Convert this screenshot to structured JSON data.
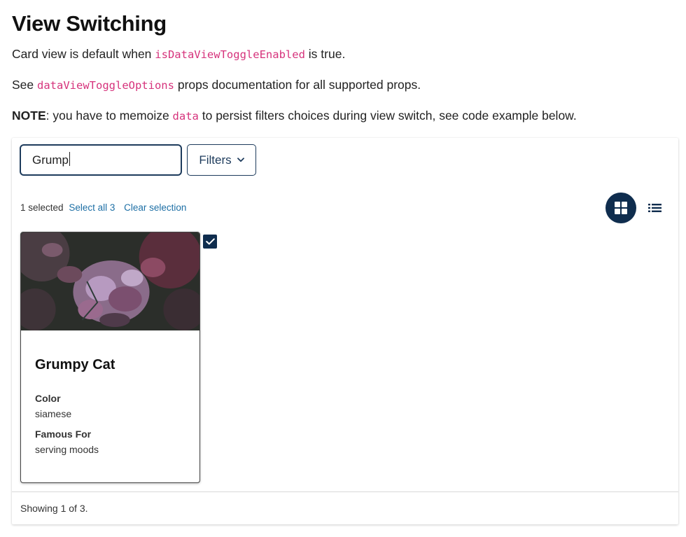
{
  "header": {
    "title": "View Switching",
    "p1_before": "Card view is default when ",
    "p1_code": "isDataViewToggleEnabled",
    "p1_after": " is true.",
    "p2_before": "See ",
    "p2_code": "dataViewToggleOptions",
    "p2_after": " props documentation for all supported props.",
    "p3_bold": "NOTE",
    "p3_mid": ": you have to memoize ",
    "p3_code": "data",
    "p3_after": " to persist filters choices during view switch, see code example below."
  },
  "toolbar": {
    "search_value": "Grump",
    "filters_label": "Filters"
  },
  "selection": {
    "count_text": "1 selected",
    "select_all_label": "Select all 3",
    "clear_label": "Clear selection"
  },
  "view_toggle": {
    "active": "card",
    "icons": [
      "grid-icon",
      "list-icon"
    ]
  },
  "cards": [
    {
      "title": "Grumpy Cat",
      "selected": true,
      "fields": [
        {
          "label": "Color",
          "value": "siamese"
        },
        {
          "label": "Famous For",
          "value": "serving moods"
        }
      ]
    }
  ],
  "footer": {
    "status": "Showing 1 of 3."
  },
  "colors": {
    "accent": "#0f2d4e",
    "link": "#1d6fa5",
    "code": "#d6337c"
  }
}
